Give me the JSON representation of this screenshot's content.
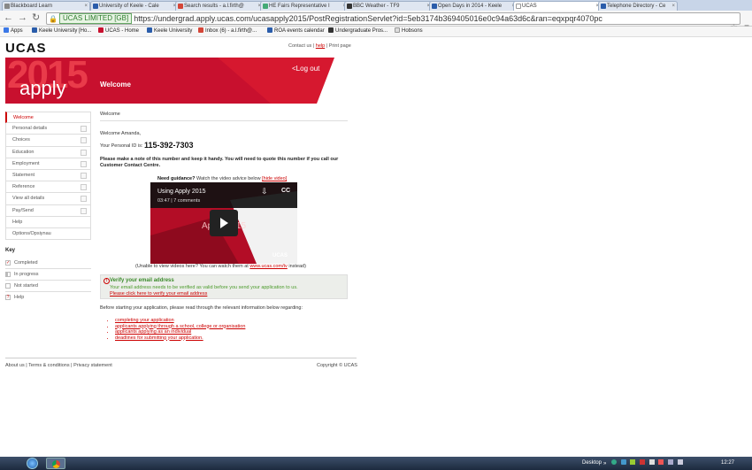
{
  "browser": {
    "tabs": [
      {
        "title": "Blackboard Learn"
      },
      {
        "title": "University of Keele - Cale"
      },
      {
        "title": "Search results - a.l.firth@"
      },
      {
        "title": "HE Fairs Representative I"
      },
      {
        "title": "BBC Weather - TF9"
      },
      {
        "title": "Open Days in 2014 - Keele"
      },
      {
        "title": "UCAS"
      },
      {
        "title": "Telephone Directory - Ce"
      }
    ],
    "ev_label": "UCAS LIMITED [GB]",
    "url": "https://undergrad.apply.ucas.com/ucasapply2015/PostRegistrationServlet?id=5eb3174b369405016e0c94a63d6c&ran=eqxpqr4070pc",
    "bookmarks": [
      {
        "label": "Apps",
        "color": "#3b78e7"
      },
      {
        "label": "Keele University [Ho...",
        "color": "#2a5caa"
      },
      {
        "label": "UCAS - Home",
        "color": "#c8102e"
      },
      {
        "label": "Keele University",
        "color": "#2a5caa"
      },
      {
        "label": "Inbox (6) - a.l.firth@...",
        "color": "#d44638"
      },
      {
        "label": "ROA events calendar",
        "color": "#2a5caa"
      },
      {
        "label": "Undergraduate Pros...",
        "color": "#333333"
      },
      {
        "label": "Hobsons",
        "color": "#999999"
      }
    ]
  },
  "header": {
    "logo": "UCAS",
    "contact": "Contact us",
    "help": "help",
    "print": "Print page",
    "year": "2015",
    "apply": "apply",
    "welcome": "Welcome",
    "logout": "<Log out"
  },
  "sidebar": {
    "items": [
      {
        "label": "Welcome",
        "selected": true
      },
      {
        "label": "Personal details"
      },
      {
        "label": "Choices"
      },
      {
        "label": "Education"
      },
      {
        "label": "Employment"
      },
      {
        "label": "Statement"
      },
      {
        "label": "Reference"
      },
      {
        "label": "View all details"
      },
      {
        "label": "Pay/Send"
      },
      {
        "label": "Help"
      },
      {
        "label": "Options/Opsiynau"
      }
    ],
    "key_title": "Key",
    "key": [
      {
        "label": "Completed",
        "mark": "✓"
      },
      {
        "label": "In progress",
        "mark": ""
      },
      {
        "label": "Not started",
        "mark": ""
      },
      {
        "label": "Help",
        "mark": "?"
      }
    ]
  },
  "main": {
    "breadcrumb": "Welcome",
    "greeting": "Welcome Amanda,",
    "pid_label": "Your Personal ID is:",
    "pid": "115-392-7303",
    "note": "Please make a note of this number and keep it handy. You will need to quote this number if you call our Customer Contact Centre.",
    "guidance_bold": "Need guidance?",
    "guidance_text": " Watch the video advice below ",
    "hide_video": "[hide video]",
    "video": {
      "title": "Using Apply 2015",
      "meta": "03:47 | 7 comments",
      "overlay": "Apply 2015",
      "brand": "UCAS",
      "cc": "CC"
    },
    "unable_pre": "(Unable to view videos here? You can watch them at ",
    "unable_link": "www.ucas.com/tv",
    "unable_post": " instead)",
    "verify": {
      "heading": "Verify your email address",
      "text": "Your email address needs to be verified as valid before you send your application to us.",
      "link": "Please click here to verify your email address"
    },
    "before": "Before starting your application, please read through the relevant information below regarding:",
    "links": [
      "completing your application",
      "applicants applying through a school, college or organisation",
      "applicants applying as an individual",
      "deadlines for submitting your application."
    ]
  },
  "footer": {
    "about": "About us",
    "terms": "Terms & conditions",
    "privacy": "Privacy statement",
    "copyright": "Copyright © UCAS"
  },
  "taskbar": {
    "desktop": "Desktop",
    "clock": "12:27"
  }
}
